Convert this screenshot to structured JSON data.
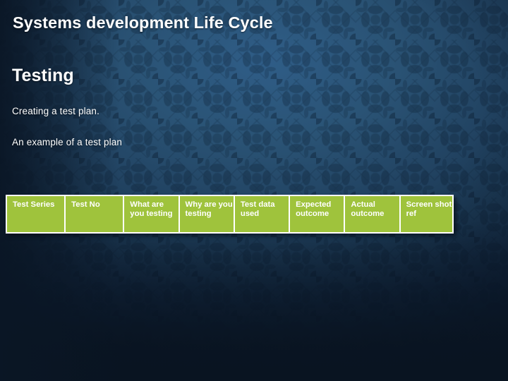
{
  "slide": {
    "title": "Systems development Life Cycle",
    "section_heading": "Testing",
    "body_lines": [
      "Creating a test plan.",
      "An example of a test plan"
    ]
  },
  "table": {
    "name": "test-plan-table",
    "header_fill": "#9fc33c",
    "header_text_color": "#ffffff",
    "border_color": "#ffffff",
    "columns": [
      "Test Series",
      "Test No",
      "What are you testing",
      "Why are you testing",
      "Test data used",
      "Expected outcome",
      "Actual outcome",
      "Screen shot ref"
    ],
    "rows": []
  },
  "theme": {
    "background_center": "#2f5d87",
    "background_edge": "#0b1727",
    "accent_green": "#9fc33c",
    "text_color": "#ffffff"
  }
}
